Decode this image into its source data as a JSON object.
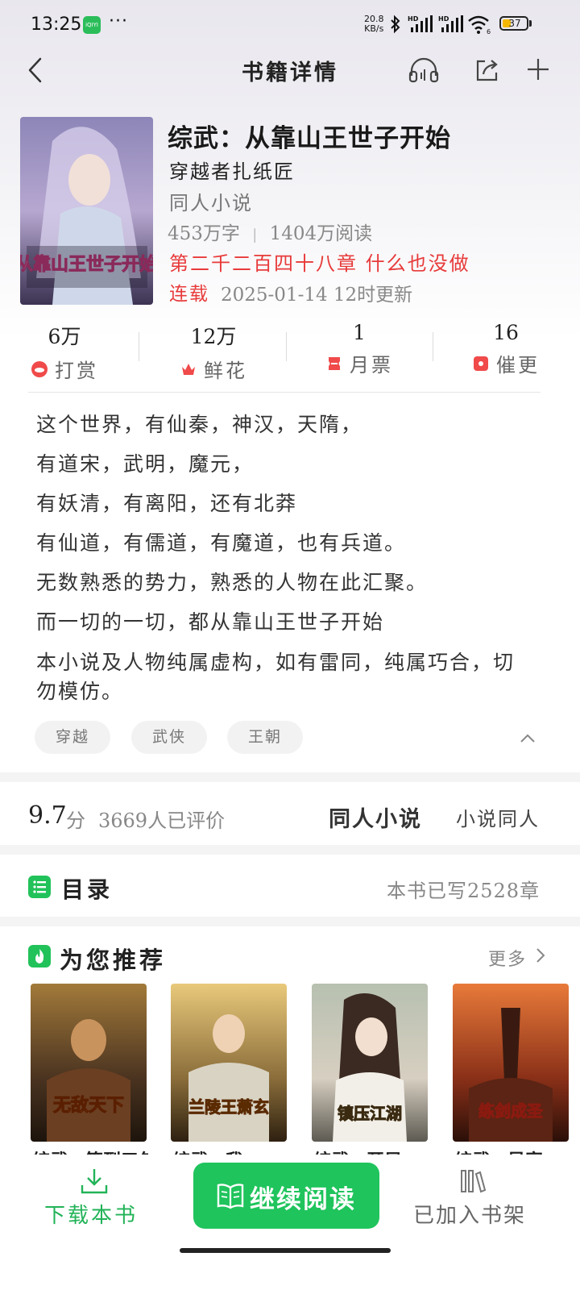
{
  "status_bar": {
    "time": "13:25",
    "app_badge": "iQIYI",
    "more": "···",
    "net_speed_value": "20.8",
    "net_speed_unit": "KB/s",
    "battery": "37",
    "battery_level": 0.37,
    "accent": "#f5b800"
  },
  "nav": {
    "title": "书籍详情",
    "icons": [
      "back-icon",
      "headphones-icon",
      "share-icon",
      "plus-icon"
    ]
  },
  "book": {
    "title": "综武：从靠山王世子开始",
    "author": "穿越者扎纸匠",
    "category": "同人小说",
    "words": "453万字",
    "stats_sep": "|",
    "reads": "1404万阅读",
    "latest_chapter": "第二千二百四十八章 什么也没做",
    "status": "连载",
    "update": "2025-01-14 12时更新",
    "cover_text": "从靠山王世子开始"
  },
  "stats": [
    {
      "value": "6万",
      "label": "打赏",
      "icon": "reward-icon"
    },
    {
      "value": "12万",
      "label": "鲜花",
      "icon": "flower-icon"
    },
    {
      "value": "1",
      "label": "月票",
      "icon": "ticket-icon"
    },
    {
      "value": "16",
      "label": "催更",
      "icon": "urge-icon"
    }
  ],
  "synopsis": [
    "这个世界，有仙秦，神汉，天隋，",
    "有道宋，武明，魔元，",
    "有妖清，有离阳，还有北莽",
    "有仙道，有儒道，有魔道，也有兵道。",
    "无数熟悉的势力，熟悉的人物在此汇聚。",
    "而一切的一切，都从靠山王世子开始",
    "本小说及人物纯属虚构，如有雷同，纯属巧合，切勿模仿。"
  ],
  "tags": [
    "穿越",
    "武侠",
    "王朝"
  ],
  "rating": {
    "score": "9.7",
    "unit": "分",
    "count": "3669人已评价",
    "tag_primary": "同人小说",
    "tag_secondary": "小说同人"
  },
  "toc": {
    "title": "目录",
    "count": "本书已写2528章"
  },
  "recommend": {
    "title": "为您推荐",
    "more": "更多",
    "books": [
      {
        "title": "综武：签到五年联已",
        "cover_text": "无敌天下"
      },
      {
        "title": "综武：我",
        "cover_text": "兰陵王萧玄"
      },
      {
        "title": "综武：开局",
        "cover_text": "镇压江湖"
      },
      {
        "title": "综武：吴家",
        "cover_text": "练剑成圣"
      }
    ]
  },
  "bottom_bar": {
    "download": "下载本书",
    "continue": "继续阅读",
    "shelf": "已加入书架"
  },
  "colors": {
    "brand_green": "#1fc45c",
    "alert_red": "#e83a3a"
  }
}
